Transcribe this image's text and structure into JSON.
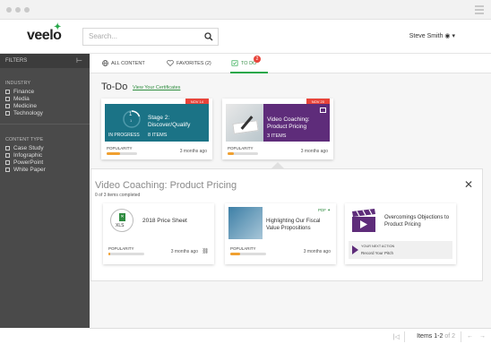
{
  "brand": {
    "logo_text": "veelo",
    "accent": "#27a84a"
  },
  "search": {
    "placeholder": "Search..."
  },
  "user": {
    "name": "Steve Smith"
  },
  "sidebar": {
    "header": "FILTERS",
    "industry_label": "INDUSTRY",
    "industries": [
      "Finance",
      "Media",
      "Medicine",
      "Technology"
    ],
    "content_type_label": "CONTENT TYPE",
    "content_types": [
      "Case Study",
      "Infographic",
      "PowerPoint",
      "White Paper"
    ]
  },
  "tabs": {
    "all": "ALL CONTENT",
    "favorites": "FAVORITES (2)",
    "todo": "TO DO",
    "todo_badge": "2"
  },
  "todo": {
    "heading": "To-Do",
    "cert_link": "View Your Certificates"
  },
  "cards": [
    {
      "tag": "NOV 14",
      "title": "Stage 2: Discover/Qualify",
      "status": "IN PROGRESS",
      "items": "8 ITEMS",
      "ring": "1",
      "ring_sub": "1",
      "popularity_label": "POPULARITY",
      "popularity": 0.45,
      "ago": "3 months ago",
      "color": "#1b7386"
    },
    {
      "tag": "NOV 20",
      "title": "Video Coaching: Product Pricing",
      "items": "3 ITEMS",
      "popularity_label": "POPULARITY",
      "popularity": 0.2,
      "ago": "3 months ago",
      "color": "#5e2c7a"
    }
  ],
  "panel": {
    "title": "Video Coaching: Product Pricing",
    "subtitle": "0 of 3 items completed",
    "items": [
      {
        "title": "2018 Price Sheet",
        "type": "XLS",
        "popularity_label": "POPULARITY",
        "popularity": 0.05,
        "ago": "3 months ago"
      },
      {
        "title": "Highlighting Our Fiscal Value Propositions",
        "type": "PDF",
        "popularity_label": "POPULARITY",
        "popularity": 0.28,
        "ago": "3 months ago"
      },
      {
        "title": "Overcomings Objections to Product Pricing",
        "next_label": "YOUR NEXT ACTION",
        "next_action": "Record Your Pitch"
      }
    ]
  },
  "footer": {
    "items_label": "Items 1-2",
    "of_label": "of 2"
  }
}
